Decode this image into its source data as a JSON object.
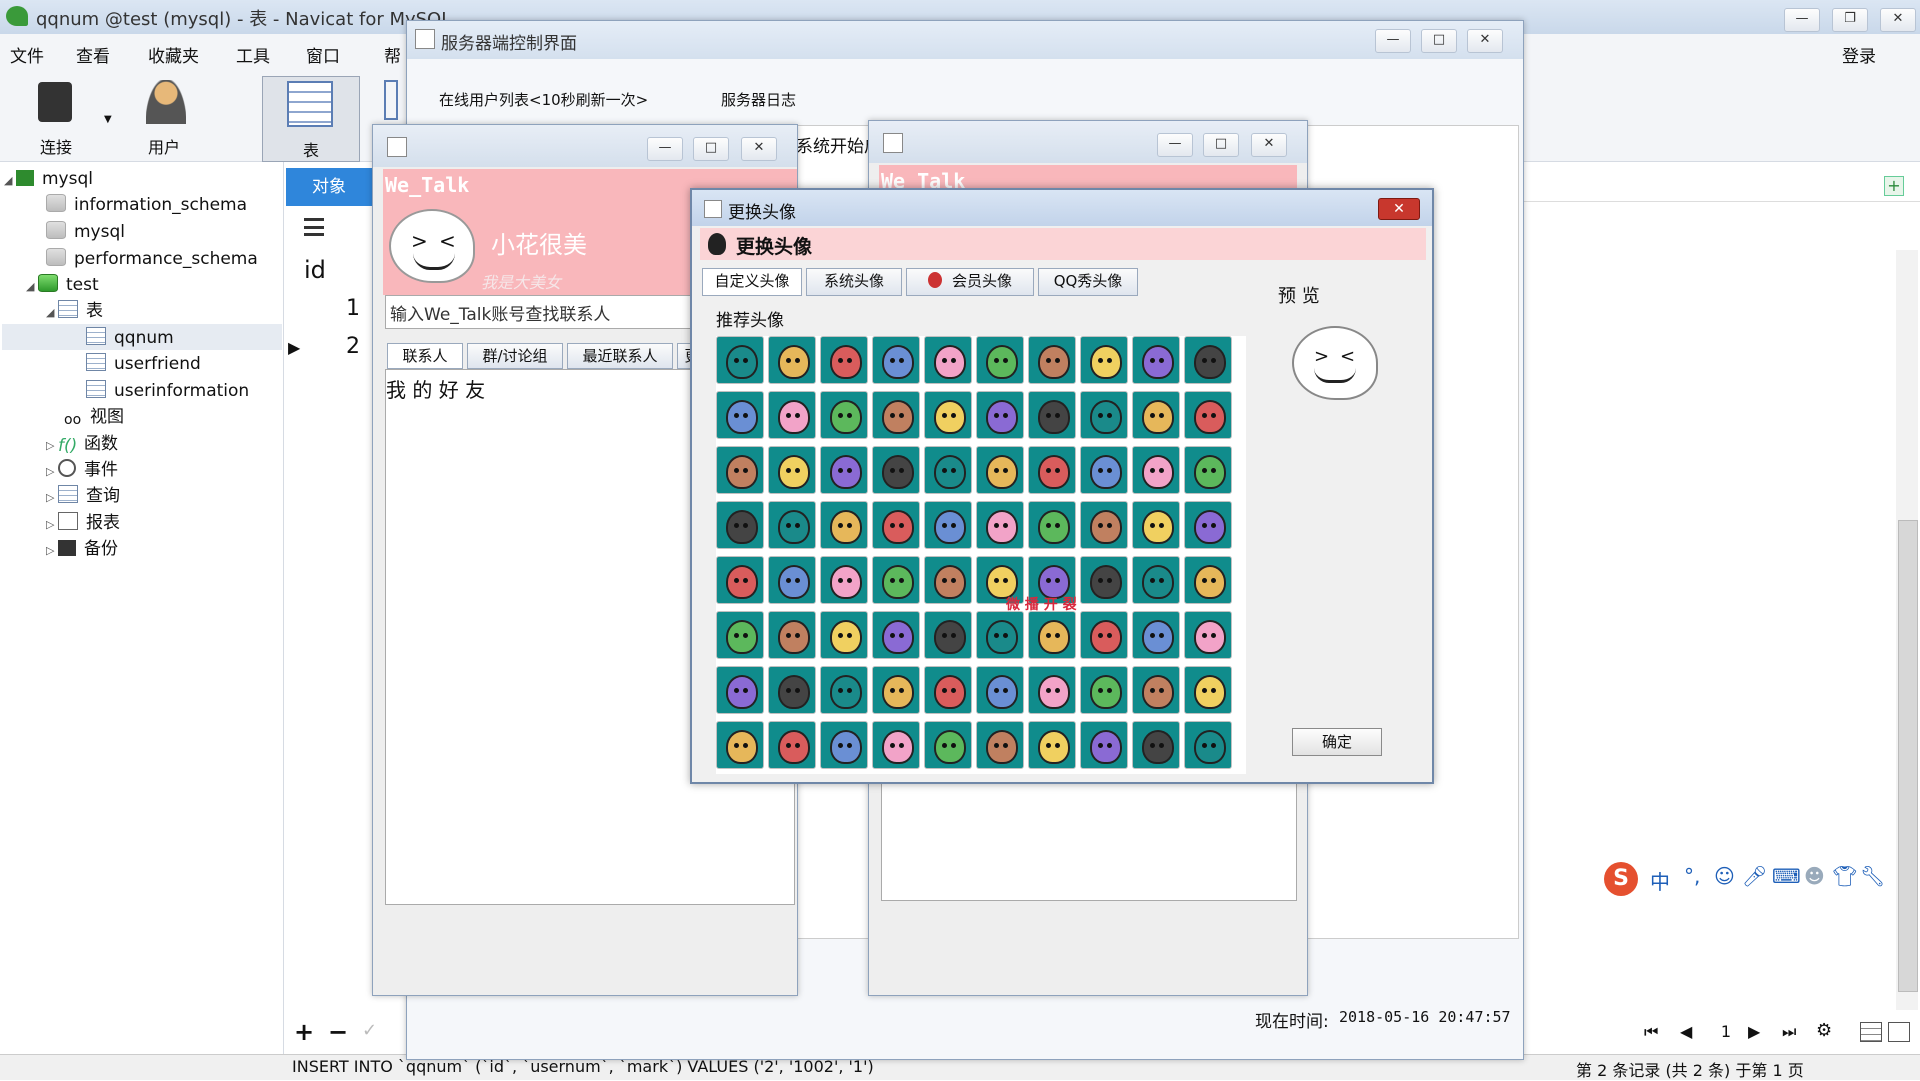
{
  "navicat": {
    "title": "qqnum @test (mysql) - 表 - Navicat for MySQL",
    "menu": [
      "文件",
      "查看",
      "收藏夹",
      "工具",
      "窗口",
      "帮"
    ],
    "login": "登录",
    "toolbar": {
      "connect": "连接",
      "user": "用户",
      "table": "表"
    },
    "tree": {
      "root": "mysql",
      "dbs": [
        "information_schema",
        "mysql",
        "performance_schema"
      ],
      "test_db": "test",
      "tables_node": "表",
      "tables": [
        "qqnum",
        "userfriend",
        "userinformation"
      ],
      "others": [
        "视图",
        "函数",
        "事件",
        "查询",
        "报表",
        "备份"
      ]
    },
    "object_tab": "对象",
    "grid": {
      "column": "id",
      "rows": [
        "1",
        "2"
      ]
    },
    "page_number": "1",
    "sql_status": "INSERT INTO `qqnum` (`id`, `usernum`, `mark`) VALUES ('2', '1002', '1')",
    "record_status": "第 2 条记录 (共 2 条) 于第 1 页"
  },
  "server_window": {
    "title": "服务器端控制界面",
    "tabs": [
      "在线用户列表<10秒刷新一次>",
      "服务器日志"
    ],
    "log_fragment": "系统开始启",
    "time_label": "现在时间:",
    "time_value": "2018-05-16 20:47:57"
  },
  "client_left": {
    "brand": "We_Talk",
    "nickname": "小花很美",
    "signature": "我是大美女",
    "search_placeholder": "输入We_Talk账号查找联系人",
    "tabs": [
      "联系人",
      "群/讨论组",
      "最近联系人",
      "更"
    ],
    "group_label": "我 的 好 友"
  },
  "client_right": {
    "brand": "We_Talk"
  },
  "avatar_dialog": {
    "window_title": "更换头像",
    "header": "更换头像",
    "tabs": [
      "自定义头像",
      "系统头像",
      "会员头像",
      "QQ秀头像"
    ],
    "section_label": "推荐头像",
    "preview_label": "预 览",
    "confirm": "确定",
    "watermark": "微 播 开 裂",
    "colors": {
      "header_bg": "#fbd4d6",
      "teal": "#108c8c",
      "close_red": "#c8372d"
    },
    "avatars": [
      [
        "frog-green",
        "dog-blue",
        "rabbit-white",
        "beard-man",
        "red-hair-girl",
        "old-man",
        "chick-yellow",
        "nurse",
        "chef",
        "cat-grey"
      ],
      [
        "boy-dark",
        "bunny-pink",
        "mustache-man",
        "bearded-man",
        "baby",
        "penguin-qq",
        "rabbit-blue",
        "panda",
        "girl-red",
        "duck-yellow"
      ],
      [
        "wolf-blue",
        "wolf-grey",
        "tiger",
        "lion",
        "cat-white",
        "boy-brown",
        "man-black",
        "girl-red-hair",
        "girl-purple",
        "pig-pink"
      ],
      [
        "duck-green",
        "bear",
        "girl-black",
        "old-monk",
        "cool-man",
        "blonde-girl",
        "girl-pink",
        "dragon-blue",
        "girl-blonde",
        "penguin"
      ],
      [
        "dog-white",
        "boy-cap",
        "smiling-man",
        "man-brown",
        "boy-glasses",
        "boy-black",
        "fox-yellow",
        "girl-red-2",
        "man-black-2",
        "girl-red-3"
      ],
      [
        "man-glasses",
        "doraemon",
        "boy-red-cap",
        "girl-green",
        "mouse-yellow",
        "boy-blue-hair",
        "girl-purple-2",
        "baby-2",
        "girl-orange",
        "man-dark"
      ],
      [
        "girl-blue",
        "santa",
        "dolphin",
        "fox-red",
        "frog-2",
        "girl-purple-3",
        "man-beard",
        "tiger-2",
        "girl-brown",
        "robot"
      ],
      [
        "girl-auburn",
        "cow",
        "man-suit",
        "girl-pink-2",
        "chick-2",
        "man-brown-2",
        "girl-pink-3",
        "police",
        "man-black-3",
        "punk-man"
      ]
    ]
  },
  "ime": {
    "label": "中"
  }
}
